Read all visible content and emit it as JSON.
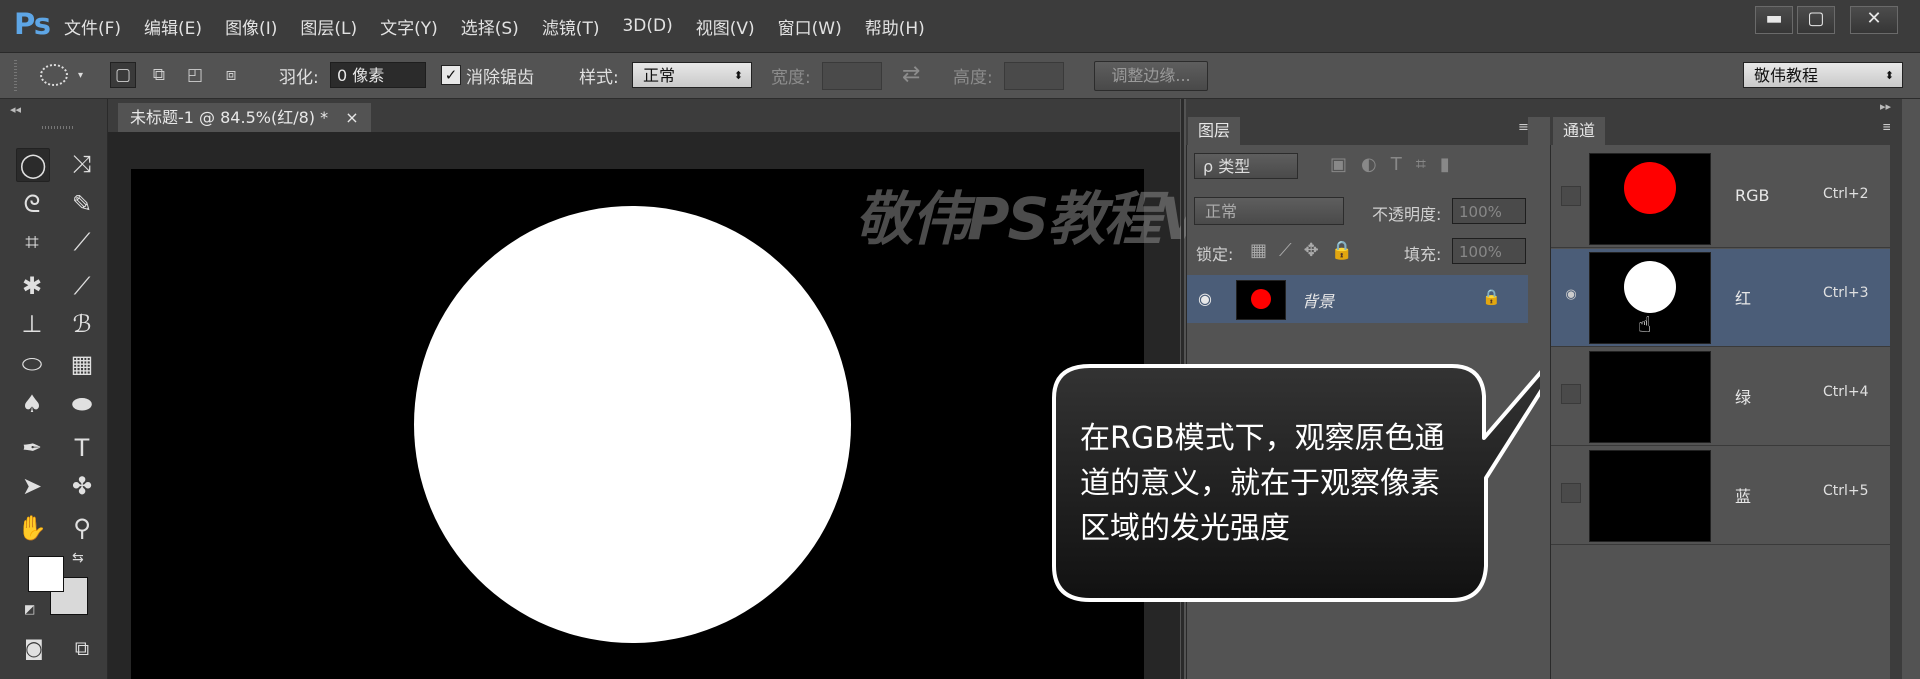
{
  "app": {
    "logo": "Ps"
  },
  "menu": [
    "文件(F)",
    "编辑(E)",
    "图像(I)",
    "图层(L)",
    "文字(Y)",
    "选择(S)",
    "滤镜(T)",
    "3D(D)",
    "视图(V)",
    "窗口(W)",
    "帮助(H)"
  ],
  "window_buttons": {
    "minimize": "▬",
    "maximize": "▢",
    "close": "✕"
  },
  "options": {
    "feather_label": "羽化:",
    "feather_value": "0 像素",
    "antialias_label": "消除锯齿",
    "antialias_checked": true,
    "style_label": "样式:",
    "style_value": "正常",
    "width_label": "宽度:",
    "height_label": "高度:",
    "refine_edge": "调整边缘...",
    "workspace": "敬伟教程"
  },
  "document": {
    "tab_title": "未标题-1 @ 84.5%(红/8) *",
    "close": "×",
    "canvas_color": "#000000",
    "circle_color": "#ffffff"
  },
  "watermark": "敬伟PS教程VIP高清版",
  "layers_panel": {
    "tab": "图层",
    "filter_label": "ρ 类型",
    "blend_mode": "正常",
    "opacity_label": "不透明度:",
    "opacity_value": "100%",
    "lock_label": "锁定:",
    "fill_label": "填充:",
    "fill_value": "100%",
    "layers": [
      {
        "name": "背景",
        "locked": true,
        "thumb_color": "#ff0000"
      }
    ]
  },
  "channels_panel": {
    "tab": "通道",
    "channels": [
      {
        "name": "RGB",
        "shortcut": "Ctrl+2",
        "thumb_dot": "#ff0000",
        "visible": false,
        "selected": false
      },
      {
        "name": "红",
        "shortcut": "Ctrl+3",
        "thumb_dot": "#ffffff",
        "visible": true,
        "selected": true
      },
      {
        "name": "绿",
        "shortcut": "Ctrl+4",
        "thumb_dot": "",
        "visible": false,
        "selected": false
      },
      {
        "name": "蓝",
        "shortcut": "Ctrl+5",
        "thumb_dot": "",
        "visible": false,
        "selected": false
      }
    ]
  },
  "callout": {
    "text": "在RGB模式下，观察原色通道的意义，就在于观察像素区域的发光强度"
  },
  "colors": {
    "accent": "#4b5d78",
    "foreground": "#ffffff",
    "background": "#d9d9d9"
  }
}
